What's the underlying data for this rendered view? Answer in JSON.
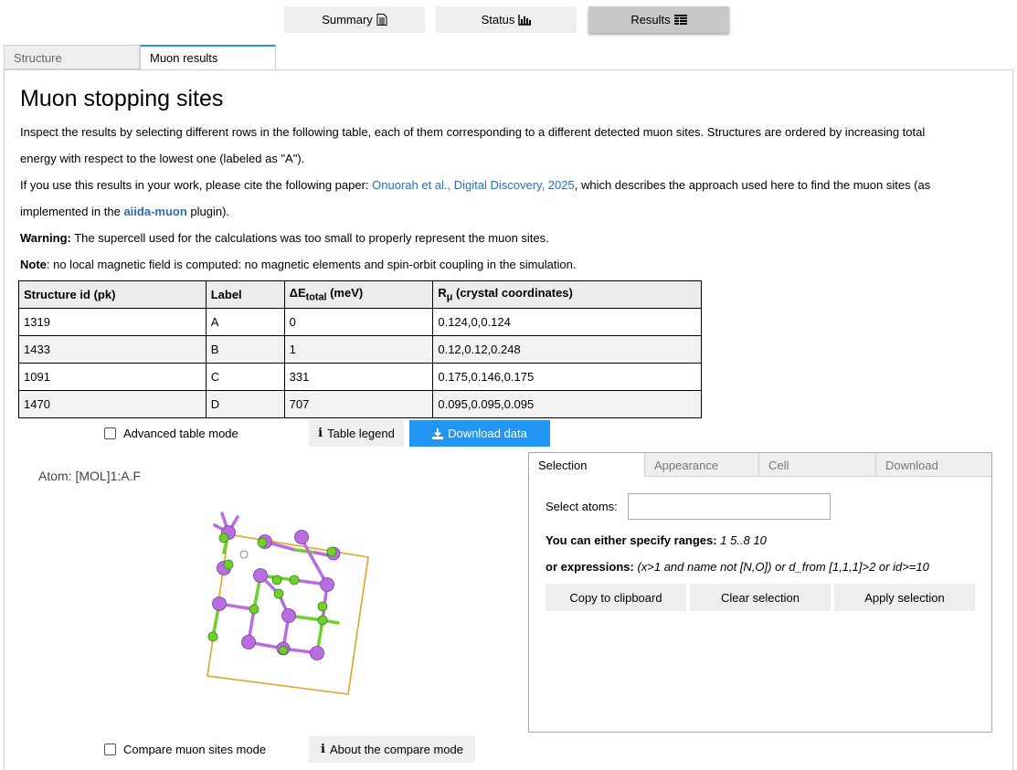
{
  "top_buttons": [
    {
      "label": "Summary",
      "icon": "document-icon"
    },
    {
      "label": "Status",
      "icon": "bar-chart-icon"
    },
    {
      "label": "Results",
      "icon": "table-icon"
    }
  ],
  "tabs": [
    "Structure",
    "Muon results"
  ],
  "page": {
    "title": "Muon stopping sites",
    "intro_line1": "Inspect the results by selecting different rows in the following table, each of them corresponding to a different detected muon sites. Structures are ordered by increasing total",
    "intro_line2": "energy with respect to the lowest one (labeled as \"A\").",
    "cite_prefix": "If you use this results in your work, please cite the following paper: ",
    "cite_link": "Onuorah et al., Digital Discovery, 2025",
    "cite_suffix": ", which describes the approach used here to find the muon sites (as",
    "cite_line2_prefix": "implemented in the ",
    "cite_plugin": "aiida-muon",
    "cite_line2_suffix": " plugin).",
    "warning_label": "Warning:",
    "warning_text": " The supercell used for the calculations was too small to properly represent the muon sites.",
    "note_label": "Note",
    "note_text": ": no local magnetic field is computed: no magnetic elements and spin-orbit coupling in the simulation."
  },
  "table": {
    "headers": {
      "id": "Structure id (pk)",
      "label": "Label",
      "energy_prefix": "ΔE",
      "energy_sub": "total",
      "energy_suffix": " (meV)",
      "pos_prefix": "R",
      "pos_sub": "μ",
      "pos_suffix": " (crystal coordinates)"
    },
    "rows": [
      {
        "id": "1319",
        "label": "A",
        "energy": "0",
        "pos": "0.124,0,0.124"
      },
      {
        "id": "1433",
        "label": "B",
        "energy": "1",
        "pos": "0.12,0.12,0.248"
      },
      {
        "id": "1091",
        "label": "C",
        "energy": "331",
        "pos": "0.175,0.146,0.175"
      },
      {
        "id": "1470",
        "label": "D",
        "energy": "707",
        "pos": "0.095,0.095,0.095"
      }
    ]
  },
  "controls": {
    "advanced_mode": "Advanced table mode",
    "table_legend": "Table legend",
    "download_data": "Download data",
    "compare_mode": "Compare muon sites mode",
    "about_compare": "About the compare mode"
  },
  "viewer": {
    "atom_label": "Atom: [MOL]1:A.F",
    "colors": {
      "cell": "#e0a526",
      "atom_purple": "#b86ee0",
      "atom_green": "#6fcf2e"
    }
  },
  "panel": {
    "tabs": [
      "Selection",
      "Appearance",
      "Cell",
      "Download"
    ],
    "select_atoms_label": "Select atoms:",
    "select_atoms_value": "",
    "ranges_label": "You can either specify ranges:",
    "ranges_example": " 1 5..8 10",
    "expr_label": "or expressions:",
    "expr_example": " (x>1 and name not [N,O]) or d_from [1,1,1]>2 or id>=10",
    "buttons": [
      "Copy to clipboard",
      "Clear selection",
      "Apply selection"
    ]
  },
  "colors": {
    "accent": "#2196f3",
    "link": "#2a6fb5"
  }
}
